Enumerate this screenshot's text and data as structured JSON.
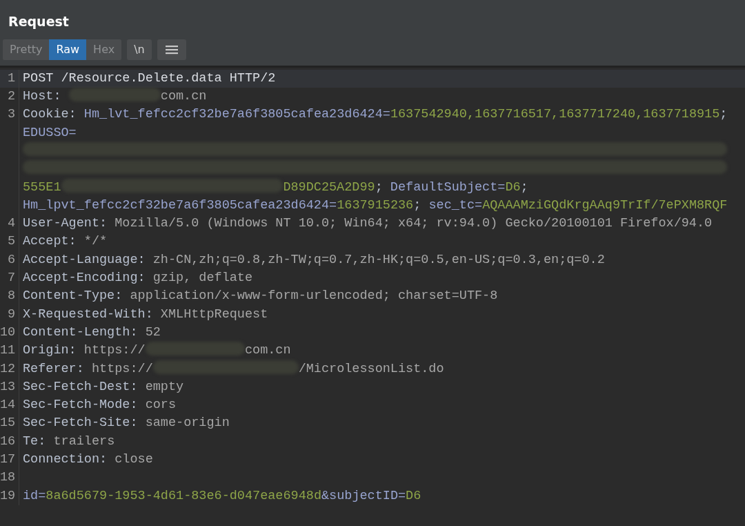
{
  "panel": {
    "title": "Request"
  },
  "tabs": [
    {
      "label": "Pretty",
      "selected": false
    },
    {
      "label": "Raw",
      "selected": true
    },
    {
      "label": "Hex",
      "selected": false
    }
  ],
  "toolbar_buttons": [
    {
      "kind": "text",
      "label": "\\n"
    },
    {
      "kind": "menu"
    }
  ],
  "editor": {
    "lines": [
      {
        "number": "1",
        "current": true,
        "rows": [
          {
            "segments": [
              {
                "kind": "plain",
                "text": "POST /Resource.Delete.data HTTP/2"
              }
            ]
          }
        ]
      },
      {
        "number": "2",
        "current": false,
        "rows": [
          {
            "segments": [
              {
                "kind": "header",
                "text": "Host: "
              },
              {
                "kind": "redacted"
              },
              {
                "kind": "value",
                "text": "com.cn"
              }
            ]
          }
        ]
      },
      {
        "number": "3",
        "current": false,
        "rows": [
          {
            "segments": [
              {
                "kind": "header",
                "text": "Cookie: "
              },
              {
                "kind": "param",
                "text": "Hm_lvt_fefcc2cf32be7a6f3805cafea23d6424="
              },
              {
                "kind": "param-value",
                "text": "1637542940,1637716517,1637717240,1637718915"
              },
              {
                "kind": "header",
                "text": ";"
              }
            ]
          },
          {
            "segments": [
              {
                "kind": "param",
                "text": "EDUSSO="
              }
            ]
          },
          {
            "segments": [
              {
                "kind": "redacted"
              }
            ]
          },
          {
            "segments": [
              {
                "kind": "redacted"
              }
            ]
          },
          {
            "segments": [
              {
                "kind": "param-value",
                "text": "555E1"
              },
              {
                "kind": "redacted"
              },
              {
                "kind": "param-value",
                "text": "D89DC25A2D99"
              },
              {
                "kind": "header",
                "text": "; "
              },
              {
                "kind": "param",
                "text": "DefaultSubject="
              },
              {
                "kind": "param-value",
                "text": "D6"
              },
              {
                "kind": "header",
                "text": ";"
              }
            ]
          },
          {
            "segments": [
              {
                "kind": "param",
                "text": "Hm_lpvt_fefcc2cf32be7a6f3805cafea23d6424="
              },
              {
                "kind": "param-value",
                "text": "1637915236"
              },
              {
                "kind": "header",
                "text": "; "
              },
              {
                "kind": "param",
                "text": "sec_tc="
              },
              {
                "kind": "param-value",
                "text": "AQAAAMziGQdKrgAAq9TrIf/7ePXM8RQF"
              }
            ]
          }
        ]
      },
      {
        "number": "4",
        "current": false,
        "rows": [
          {
            "segments": [
              {
                "kind": "header",
                "text": "User-Agent: "
              },
              {
                "kind": "value",
                "text": "Mozilla/5.0 (Windows NT 10.0; Win64; x64; rv:94.0) Gecko/20100101 Firefox/94.0"
              }
            ]
          }
        ]
      },
      {
        "number": "5",
        "current": false,
        "rows": [
          {
            "segments": [
              {
                "kind": "header",
                "text": "Accept: "
              },
              {
                "kind": "value",
                "text": "*/*"
              }
            ]
          }
        ]
      },
      {
        "number": "6",
        "current": false,
        "rows": [
          {
            "segments": [
              {
                "kind": "header",
                "text": "Accept-Language: "
              },
              {
                "kind": "value",
                "text": "zh-CN,zh;q=0.8,zh-TW;q=0.7,zh-HK;q=0.5,en-US;q=0.3,en;q=0.2"
              }
            ]
          }
        ]
      },
      {
        "number": "7",
        "current": false,
        "rows": [
          {
            "segments": [
              {
                "kind": "header",
                "text": "Accept-Encoding: "
              },
              {
                "kind": "value",
                "text": "gzip, deflate"
              }
            ]
          }
        ]
      },
      {
        "number": "8",
        "current": false,
        "rows": [
          {
            "segments": [
              {
                "kind": "header",
                "text": "Content-Type: "
              },
              {
                "kind": "value",
                "text": "application/x-www-form-urlencoded; charset=UTF-8"
              }
            ]
          }
        ]
      },
      {
        "number": "9",
        "current": false,
        "rows": [
          {
            "segments": [
              {
                "kind": "header",
                "text": "X-Requested-With: "
              },
              {
                "kind": "value",
                "text": "XMLHttpRequest"
              }
            ]
          }
        ]
      },
      {
        "number": "10",
        "current": false,
        "rows": [
          {
            "segments": [
              {
                "kind": "header",
                "text": "Content-Length: "
              },
              {
                "kind": "value",
                "text": "52"
              }
            ]
          }
        ]
      },
      {
        "number": "11",
        "current": false,
        "rows": [
          {
            "segments": [
              {
                "kind": "header",
                "text": "Origin: "
              },
              {
                "kind": "value",
                "text": "https://"
              },
              {
                "kind": "redacted"
              },
              {
                "kind": "value",
                "text": "com.cn"
              }
            ]
          }
        ]
      },
      {
        "number": "12",
        "current": false,
        "rows": [
          {
            "segments": [
              {
                "kind": "header",
                "text": "Referer: "
              },
              {
                "kind": "value",
                "text": "https://"
              },
              {
                "kind": "redacted"
              },
              {
                "kind": "value",
                "text": "/MicrolessonList.do"
              }
            ]
          }
        ]
      },
      {
        "number": "13",
        "current": false,
        "rows": [
          {
            "segments": [
              {
                "kind": "header",
                "text": "Sec-Fetch-Dest: "
              },
              {
                "kind": "value",
                "text": "empty"
              }
            ]
          }
        ]
      },
      {
        "number": "14",
        "current": false,
        "rows": [
          {
            "segments": [
              {
                "kind": "header",
                "text": "Sec-Fetch-Mode: "
              },
              {
                "kind": "value",
                "text": "cors"
              }
            ]
          }
        ]
      },
      {
        "number": "15",
        "current": false,
        "rows": [
          {
            "segments": [
              {
                "kind": "header",
                "text": "Sec-Fetch-Site: "
              },
              {
                "kind": "value",
                "text": "same-origin"
              }
            ]
          }
        ]
      },
      {
        "number": "16",
        "current": false,
        "rows": [
          {
            "segments": [
              {
                "kind": "header",
                "text": "Te: "
              },
              {
                "kind": "value",
                "text": "trailers"
              }
            ]
          }
        ]
      },
      {
        "number": "17",
        "current": false,
        "rows": [
          {
            "segments": [
              {
                "kind": "header",
                "text": "Connection: "
              },
              {
                "kind": "value",
                "text": "close"
              }
            ]
          }
        ]
      },
      {
        "number": "18",
        "current": false
      },
      {
        "number": "19",
        "current": false,
        "rows": [
          {
            "segments": [
              {
                "kind": "param",
                "text": "id="
              },
              {
                "kind": "param-value",
                "text": "8a6d5679-1953-4d61-83e6-d047eae6948d"
              },
              {
                "kind": "param",
                "text": "&subjectID="
              },
              {
                "kind": "param-value",
                "text": "D6"
              }
            ]
          }
        ]
      }
    ]
  }
}
